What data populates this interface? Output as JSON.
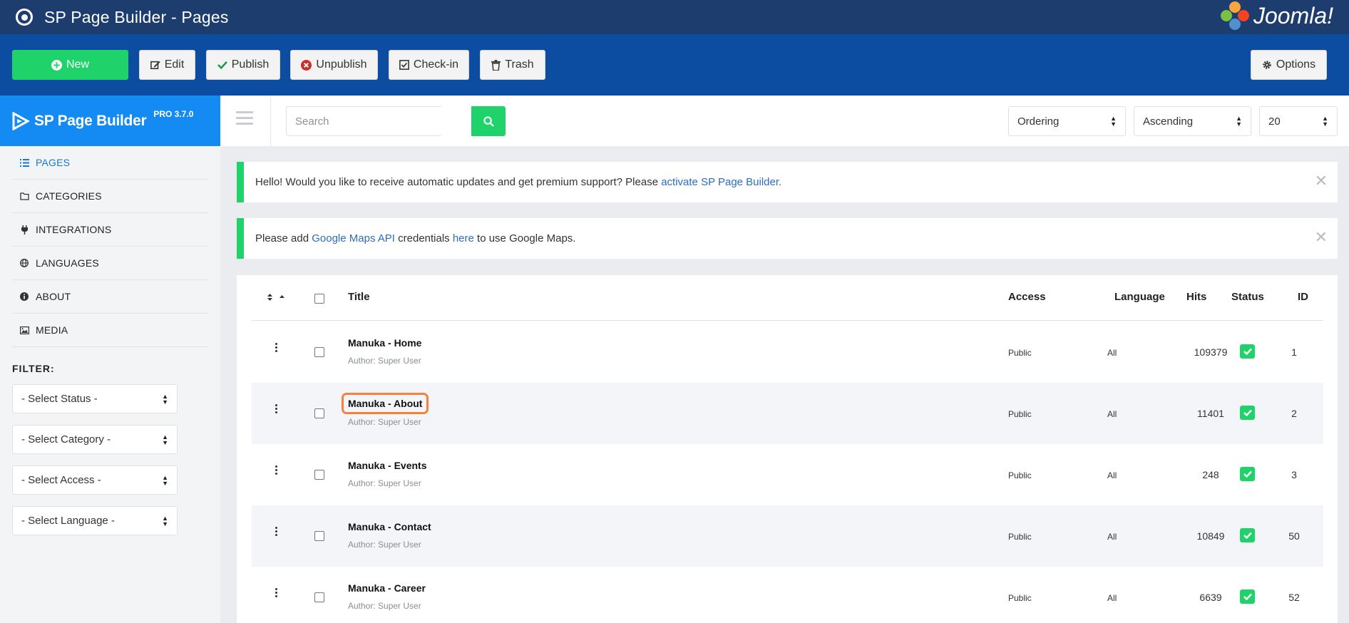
{
  "app": {
    "title": "SP Page Builder - Pages",
    "cms_logo_text": "Joomla!"
  },
  "toolbar": {
    "new": "New",
    "edit": "Edit",
    "publish": "Publish",
    "unpublish": "Unpublish",
    "checkin": "Check-in",
    "trash": "Trash",
    "options": "Options"
  },
  "brand": {
    "name": "SP Page Builder",
    "version": "PRO 3.7.0"
  },
  "sidebar": {
    "items": [
      {
        "label": "PAGES",
        "icon": "list-icon"
      },
      {
        "label": "CATEGORIES",
        "icon": "folder-icon"
      },
      {
        "label": "INTEGRATIONS",
        "icon": "plug-icon"
      },
      {
        "label": "LANGUAGES",
        "icon": "globe-icon"
      },
      {
        "label": "ABOUT",
        "icon": "info-icon"
      },
      {
        "label": "MEDIA",
        "icon": "image-icon"
      }
    ],
    "filter_label": "FILTER:",
    "filters": [
      "- Select Status -",
      "- Select Category -",
      "- Select Access -",
      "- Select Language -"
    ]
  },
  "search": {
    "placeholder": "Search"
  },
  "sort": {
    "field": "Ordering",
    "direction": "Ascending",
    "limit": "20"
  },
  "alerts": [
    {
      "pre": "Hello! Would you like to receive automatic updates and get premium support? Please ",
      "link": "activate SP Page Builder.",
      "post": ""
    },
    {
      "pre": "Please add ",
      "link": "Google Maps API",
      "mid": " credentials ",
      "link2": "here",
      "post": " to use Google Maps."
    }
  ],
  "table": {
    "headers": {
      "title": "Title",
      "access": "Access",
      "language": "Language",
      "hits": "Hits",
      "status": "Status",
      "id": "ID"
    },
    "rows": [
      {
        "title": "Manuka - Home",
        "author": "Author: Super User",
        "access": "Public",
        "language": "All",
        "hits": "109379",
        "id": "1"
      },
      {
        "title": "Manuka - About",
        "author": "Author: Super User",
        "access": "Public",
        "language": "All",
        "hits": "11401",
        "id": "2"
      },
      {
        "title": "Manuka - Events",
        "author": "Author: Super User",
        "access": "Public",
        "language": "All",
        "hits": "248",
        "id": "3"
      },
      {
        "title": "Manuka - Contact",
        "author": "Author: Super User",
        "access": "Public",
        "language": "All",
        "hits": "10849",
        "id": "50"
      },
      {
        "title": "Manuka - Career",
        "author": "Author: Super User",
        "access": "Public",
        "language": "All",
        "hits": "6639",
        "id": "52"
      }
    ]
  },
  "colors": {
    "accent_green": "#1fd26a",
    "toolbar_blue": "#0c4da2",
    "title_bar": "#1c3d6e",
    "brand_blue": "#138bf2",
    "highlight": "#f5823a"
  }
}
